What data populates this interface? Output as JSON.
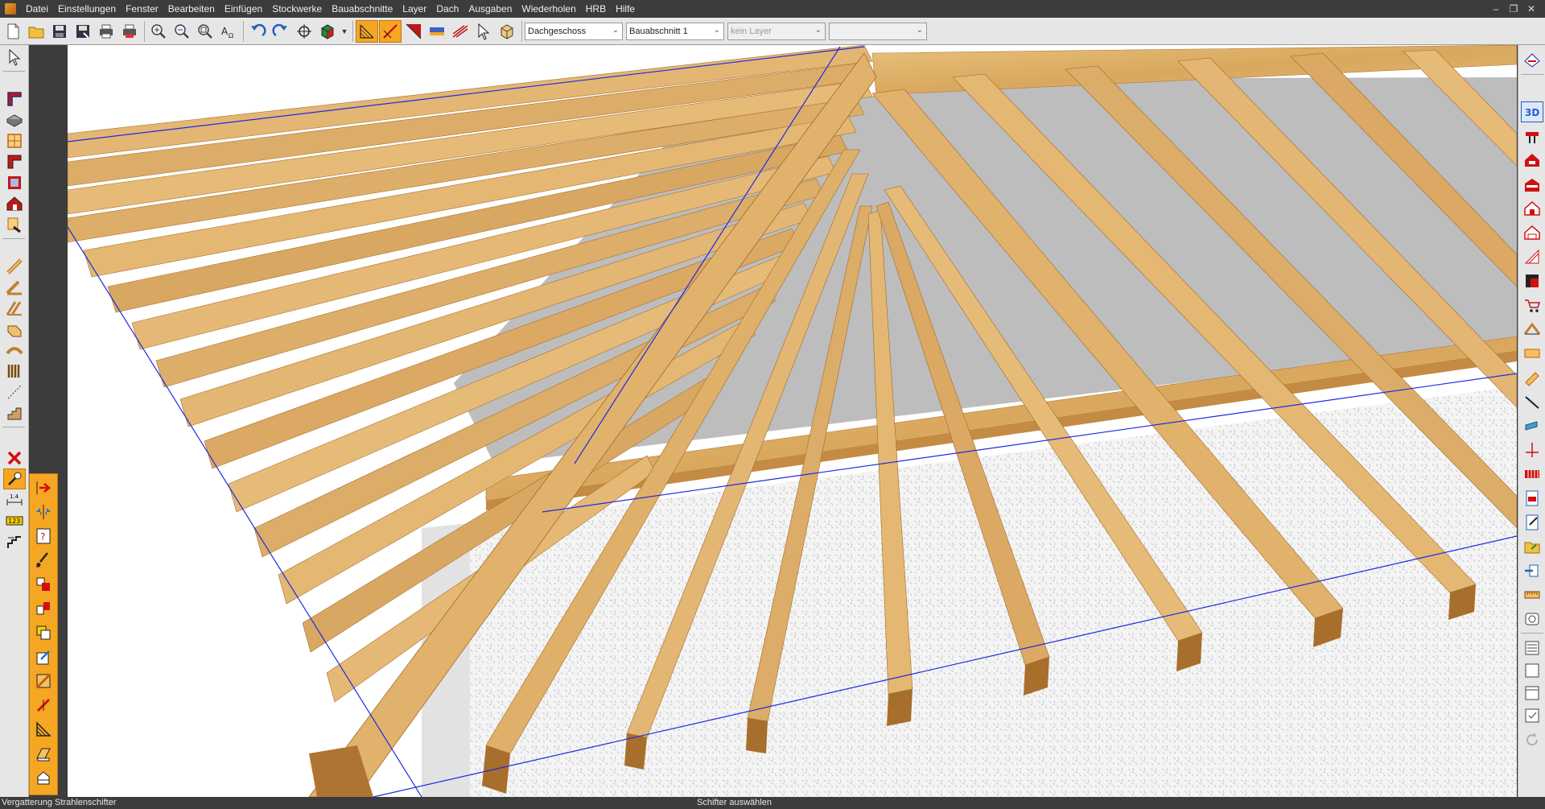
{
  "menubar": {
    "items": [
      "Datei",
      "Einstellungen",
      "Fenster",
      "Bearbeiten",
      "Einfügen",
      "Stockwerke",
      "Bauabschnitte",
      "Layer",
      "Dach",
      "Ausgaben",
      "Wiederholen",
      "HRB",
      "Hilfe"
    ]
  },
  "toolbar": {
    "floor_select": "Dachgeschoss",
    "section_select": "Bauabschnitt 1",
    "layer_select": "kein Layer",
    "empty_select": ""
  },
  "status": {
    "left": "Vergatterung Strahlenschifter",
    "center": "Schifter auswählen"
  },
  "colors": {
    "wood": "#dcae66",
    "wood_dark": "#b9803a",
    "wall": "#f2f2f2",
    "floor_gray": "#bdbdbd",
    "edge_blue": "#1e2ae0",
    "tool_orange": "#f5a623",
    "chrome_dark": "#3c3c3c"
  },
  "icons": {
    "toolbar": [
      "new-icon",
      "open-icon",
      "save-icon",
      "save-as-icon",
      "print-icon",
      "print-preview-icon",
      "zoom-in-icon",
      "zoom-out-icon",
      "zoom-window-icon",
      "text-icon",
      "undo-icon",
      "redo-icon",
      "crosshair-icon",
      "3d-box-icon"
    ],
    "roof_tools": [
      "rafter-grid-icon",
      "rafter-edit-icon",
      "roof-red-icon",
      "roof-blue-icon",
      "rafter-multi-icon",
      "pointer-icon",
      "cube-icon"
    ],
    "left": [
      "pointer-icon",
      "wall-icon",
      "slab-icon",
      "window-icon",
      "roof-icon",
      "room-icon",
      "house-icon",
      "pen-icon",
      "beam-icon",
      "rafter-icon",
      "rafter-pair-icon",
      "truss-icon",
      "arch-icon",
      "columns-icon",
      "dim-line-icon",
      "stairs-icon",
      "delete-icon",
      "wizard-icon",
      "dimension-icon",
      "numbering-icon",
      "stair-edit-icon"
    ],
    "left_sub": [
      "insert-arrow-icon",
      "mirror-icon",
      "help-icon",
      "paint-icon",
      "move-icon",
      "rotate-icon",
      "copy-icon",
      "edit-icon",
      "fill-icon",
      "split-icon",
      "slope-icon",
      "plane-icon",
      "stack-icon"
    ],
    "right": [
      "layer-icon",
      "3d-view-icon",
      "section-icon",
      "house-red-icon",
      "house-front-icon",
      "house-side-icon",
      "house-outline-icon",
      "roof-cut-icon",
      "roof-frame-icon",
      "cart-icon",
      "gable-icon",
      "panel-icon",
      "beam-yellow-icon",
      "line-icon",
      "cylinder-icon",
      "axis-icon",
      "batten-icon",
      "doc-icon",
      "doc-edit-icon",
      "folder-icon",
      "export-icon",
      "ruler-icon",
      "clock-icon",
      "list-icon",
      "frame-icon",
      "page-icon",
      "checkbox-icon",
      "refresh-icon"
    ]
  }
}
